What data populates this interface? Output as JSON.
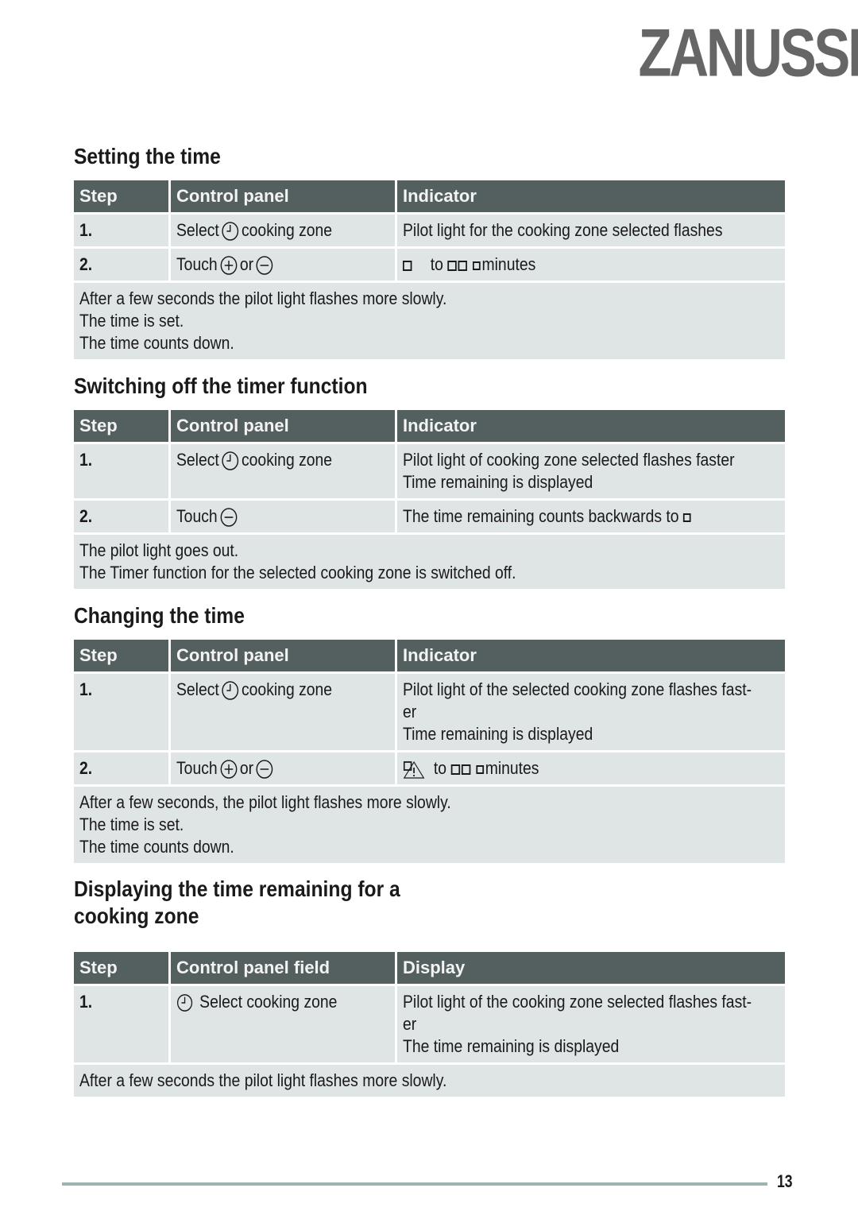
{
  "brand": {
    "logo_text": "ZANUSSI",
    "color": "#666666"
  },
  "header_color": "#545f60",
  "cell_color": "#dfe4e4",
  "sections": [
    {
      "title": "Setting the time",
      "columns": [
        "Step",
        "Control panel",
        "Indicator"
      ],
      "rows": [
        {
          "step": "1.",
          "control_prefix": "Select",
          "control_icons": [
            "timer-icon"
          ],
          "control_suffix": "cooking zone",
          "indicator": [
            "Pilot light for the cooking zone selected flashes"
          ]
        },
        {
          "step": "2.",
          "control_prefix": "Touch",
          "control_icons": [
            "plus-icon",
            "minus-icon"
          ],
          "control_join": "or",
          "indicator_segments": [
            "to",
            "minutes"
          ]
        }
      ],
      "notes": [
        "After a few seconds the pilot light flashes more slowly.",
        "The time is set.",
        "The time counts down."
      ]
    },
    {
      "title": "Switching off the timer function",
      "columns": [
        "Step",
        "Control panel",
        "Indicator"
      ],
      "rows": [
        {
          "step": "1.",
          "control_prefix": "Select",
          "control_icons": [
            "timer-icon"
          ],
          "control_suffix": "cooking zone",
          "indicator": [
            "Pilot light of cooking zone selected flashes faster",
            "Time remaining is displayed"
          ]
        },
        {
          "step": "2.",
          "control_prefix": "Touch",
          "control_icons": [
            "minus-icon"
          ],
          "indicator": [
            "The time remaining counts backwards to"
          ]
        }
      ],
      "notes": [
        "The pilot light goes out.",
        "The Timer function for the selected cooking zone is switched off."
      ]
    },
    {
      "title": "Changing the time",
      "columns": [
        "Step",
        "Control panel",
        "Indicator"
      ],
      "rows": [
        {
          "step": "1.",
          "control_prefix": "Select",
          "control_icons": [
            "timer-icon"
          ],
          "control_suffix": "cooking zone",
          "indicator": [
            "Pilot light of the selected cooking zone flashes fast-",
            "er",
            "Time remaining is displayed"
          ]
        },
        {
          "step": "2.",
          "control_prefix": "Touch",
          "control_icons": [
            "plus-icon",
            "minus-icon"
          ],
          "control_join": "or",
          "indicator_segments": [
            "to",
            "minutes"
          ]
        }
      ],
      "notes": [
        "After a few seconds, the pilot light flashes more slowly.",
        "The time is set.",
        "The time counts down."
      ]
    },
    {
      "title_lines": [
        "Displaying the time remaining for a",
        "cooking zone"
      ],
      "columns": [
        "Step",
        "Control panel field",
        "Display"
      ],
      "rows": [
        {
          "step": "1.",
          "control_icons": [
            "timer-icon"
          ],
          "control_suffix": "Select cooking zone",
          "indicator": [
            "Pilot light of the cooking zone selected flashes fast-",
            "er",
            "The time remaining is displayed"
          ]
        }
      ],
      "notes": [
        "After a few seconds the pilot light flashes more slowly."
      ]
    }
  ],
  "footer": {
    "page_number": "13"
  }
}
